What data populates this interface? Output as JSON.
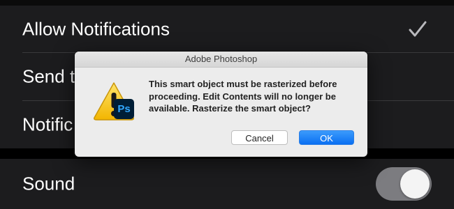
{
  "settings": {
    "rows": [
      {
        "label": "Allow Notifications",
        "icon": "checkmark-icon"
      },
      {
        "label": "Send t"
      },
      {
        "label": "Notific"
      }
    ],
    "sound": {
      "label": "Sound",
      "toggle_on": false
    }
  },
  "dialog": {
    "title": "Adobe Photoshop",
    "icon": "warning-icon",
    "app_badge": "Ps",
    "message": "This smart object must be rasterized before proceeding.  Edit Contents will no longer be available.  Rasterize the smart object?",
    "buttons": {
      "cancel": "Cancel",
      "ok": "OK"
    }
  },
  "colors": {
    "background": "#1c1c1e",
    "dialog_bg": "#ececec",
    "accent": "#0a6ff2",
    "ps_badge": "#001e36",
    "ps_text": "#31a8ff"
  }
}
